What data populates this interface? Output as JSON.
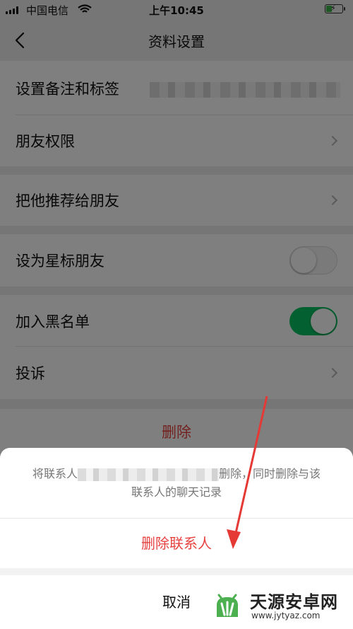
{
  "status_bar": {
    "carrier": "中国电信",
    "time": "上午10:45"
  },
  "nav": {
    "title": "资料设置"
  },
  "settings": {
    "remark_label": "设置备注和标签",
    "permission_label": "朋友权限",
    "recommend_label": "把他推荐给朋友",
    "star_label": "设为星标朋友",
    "star_on": false,
    "blacklist_label": "加入黑名单",
    "blacklist_on": true,
    "complain_label": "投诉",
    "delete_label": "删除"
  },
  "action_sheet": {
    "message_part1": "将联系人",
    "message_part2": "删除，同时删除与该",
    "message_line2": "联系人的聊天记录",
    "delete_contact": "删除联系人",
    "cancel": "取消"
  },
  "watermark": {
    "title": "天源安卓网",
    "url": "www.jytyaz.com"
  },
  "colors": {
    "toggle_on": "#07c160",
    "danger": "#e64340",
    "arrow": "#e53935"
  }
}
